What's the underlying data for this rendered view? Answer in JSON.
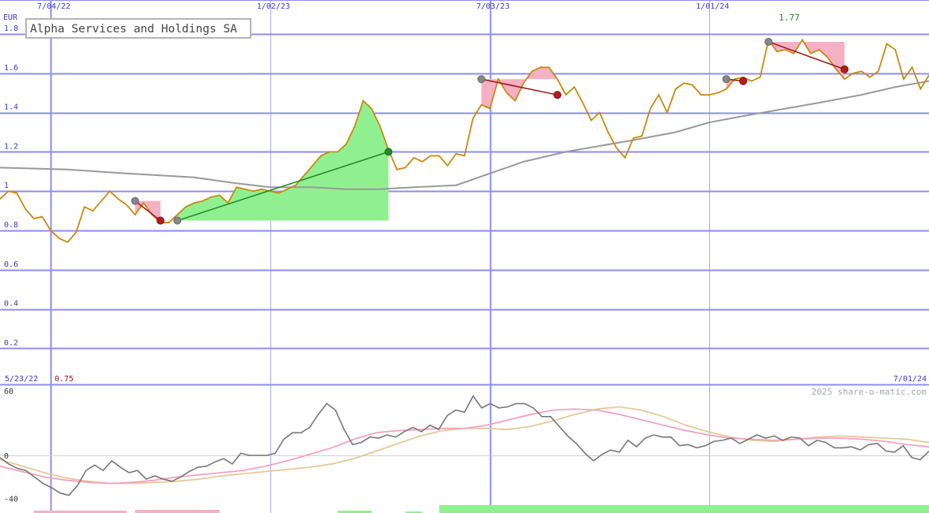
{
  "chart_data": [
    {
      "type": "line",
      "title": "Alpha Services and Holdings SA",
      "currency_label": "EUR",
      "top_date_labels": [
        "7/04/22",
        "1/02/23",
        "7/03/23",
        "1/01/24"
      ],
      "y_ticks": [
        "1.8",
        "1.6",
        "1.4",
        "1.2",
        "1",
        "0.8",
        "0.6",
        "0.4",
        "0.2"
      ],
      "ylim": [
        0,
        1.8
      ],
      "high_label": "1.77",
      "low_label": "0.75",
      "colors": {
        "price": "#c88a10",
        "average": "#999999",
        "grid_major": "#8c8cf0",
        "axis_text": "#3a3acc",
        "gain_fill": "#90f090",
        "loss_fill": "#f6b0c4",
        "gain_line": "#228822",
        "loss_line": "#991111",
        "high_text": "#228822",
        "low_text": "#991111"
      },
      "series": [
        {
          "name": "price",
          "x": [
            "2022-05-23",
            "2022-05-30",
            "2022-06-06",
            "2022-06-13",
            "2022-06-20",
            "2022-06-27",
            "2022-07-04",
            "2022-07-11",
            "2022-07-18",
            "2022-07-25",
            "2022-08-01",
            "2022-08-08",
            "2022-08-15",
            "2022-08-22",
            "2022-08-29",
            "2022-09-05",
            "2022-09-12",
            "2022-09-19",
            "2022-09-26",
            "2022-10-03",
            "2022-10-10",
            "2022-10-17",
            "2022-10-24",
            "2022-10-31",
            "2022-11-07",
            "2022-11-14",
            "2022-11-21",
            "2022-11-28",
            "2022-12-05",
            "2022-12-12",
            "2022-12-19",
            "2022-12-26",
            "2023-01-02",
            "2023-01-09",
            "2023-01-16",
            "2023-01-23",
            "2023-01-30",
            "2023-02-06",
            "2023-02-13",
            "2023-02-20",
            "2023-02-27",
            "2023-03-06",
            "2023-03-13",
            "2023-03-20",
            "2023-03-27",
            "2023-04-03",
            "2023-04-10",
            "2023-04-17",
            "2023-04-24",
            "2023-05-01",
            "2023-05-08",
            "2023-05-15",
            "2023-05-22",
            "2023-05-29",
            "2023-06-05",
            "2023-06-12",
            "2023-06-19",
            "2023-06-26",
            "2023-07-03",
            "2023-07-10",
            "2023-07-17",
            "2023-07-24",
            "2023-07-31",
            "2023-08-07",
            "2023-08-14",
            "2023-08-21",
            "2023-08-28",
            "2023-09-04",
            "2023-09-11",
            "2023-09-18",
            "2023-09-25",
            "2023-10-02",
            "2023-10-09",
            "2023-10-16",
            "2023-10-23",
            "2023-10-30",
            "2023-11-06",
            "2023-11-13",
            "2023-11-20",
            "2023-11-27",
            "2023-12-04",
            "2023-12-11",
            "2023-12-18",
            "2023-12-25",
            "2024-01-01",
            "2024-01-08",
            "2024-01-15",
            "2024-01-22",
            "2024-01-29",
            "2024-02-05",
            "2024-02-12",
            "2024-02-19",
            "2024-02-26",
            "2024-03-04",
            "2024-03-11",
            "2024-03-18",
            "2024-03-25",
            "2024-04-01",
            "2024-04-08",
            "2024-04-15",
            "2024-04-22",
            "2024-04-29",
            "2024-05-06",
            "2024-05-13",
            "2024-05-20",
            "2024-05-27",
            "2024-06-03",
            "2024-06-10",
            "2024-06-17",
            "2024-06-24",
            "2024-07-01"
          ],
          "y": [
            0.96,
            1.0,
            0.99,
            0.91,
            0.86,
            0.87,
            0.8,
            0.76,
            0.74,
            0.79,
            0.92,
            0.9,
            0.95,
            1.0,
            0.96,
            0.93,
            0.88,
            0.94,
            0.88,
            0.84,
            0.84,
            0.88,
            0.92,
            0.94,
            0.95,
            0.97,
            0.98,
            0.94,
            1.02,
            1.01,
            1.0,
            1.01,
            1.0,
            0.99,
            1.01,
            1.03,
            1.08,
            1.13,
            1.18,
            1.2,
            1.2,
            1.24,
            1.33,
            1.46,
            1.42,
            1.33,
            1.21,
            1.11,
            1.12,
            1.17,
            1.15,
            1.18,
            1.18,
            1.13,
            1.19,
            1.18,
            1.37,
            1.44,
            1.42,
            1.57,
            1.5,
            1.46,
            1.55,
            1.61,
            1.63,
            1.63,
            1.57,
            1.49,
            1.53,
            1.45,
            1.36,
            1.4,
            1.3,
            1.22,
            1.17,
            1.27,
            1.28,
            1.42,
            1.49,
            1.4,
            1.52,
            1.55,
            1.54,
            1.49,
            1.49,
            1.5,
            1.52,
            1.57,
            1.58,
            1.56,
            1.58,
            1.77,
            1.71,
            1.72,
            1.7,
            1.77,
            1.7,
            1.72,
            1.68,
            1.62,
            1.57,
            1.6,
            1.61,
            1.58,
            1.61,
            1.75,
            1.72,
            1.57,
            1.63,
            1.52,
            1.59
          ]
        },
        {
          "name": "average",
          "x": [
            "2022-05-23",
            "2022-07-18",
            "2022-09-05",
            "2022-10-31",
            "2022-12-05",
            "2023-01-02",
            "2023-02-06",
            "2023-03-06",
            "2023-04-03",
            "2023-05-01",
            "2023-06-05",
            "2023-07-03",
            "2023-07-31",
            "2023-09-04",
            "2023-10-02",
            "2023-10-30",
            "2023-12-04",
            "2024-01-01",
            "2024-02-05",
            "2024-03-04",
            "2024-04-01",
            "2024-05-06",
            "2024-06-03",
            "2024-07-01"
          ],
          "y": [
            1.12,
            1.11,
            1.09,
            1.07,
            1.04,
            1.02,
            1.02,
            1.01,
            1.01,
            1.02,
            1.03,
            1.09,
            1.15,
            1.2,
            1.23,
            1.26,
            1.3,
            1.35,
            1.39,
            1.42,
            1.45,
            1.49,
            1.53,
            1.56
          ]
        }
      ],
      "trades": [
        {
          "result": "loss",
          "entry_date": "2022-09-12",
          "entry_price": 0.95,
          "exit_date": "2022-10-03",
          "exit_price": 0.85
        },
        {
          "result": "gain",
          "entry_date": "2022-10-17",
          "entry_price": 0.85,
          "exit_date": "2023-04-10",
          "exit_price": 1.2
        },
        {
          "result": "loss",
          "entry_date": "2023-06-26",
          "entry_price": 1.57,
          "exit_date": "2023-08-28",
          "exit_price": 1.49
        },
        {
          "result": "loss",
          "entry_date": "2024-01-15",
          "entry_price": 1.57,
          "exit_date": "2024-01-29",
          "exit_price": 1.56
        },
        {
          "result": "loss",
          "entry_date": "2024-02-19",
          "entry_price": 1.76,
          "exit_date": "2024-04-22",
          "exit_price": 1.62
        }
      ]
    },
    {
      "type": "line",
      "start_date_label": "5/23/22",
      "end_date_label": "7/01/24",
      "watermark": "2025 share-o-matic.com",
      "y_ticks": [
        "60",
        "0",
        "-40"
      ],
      "ylim": [
        -40,
        60
      ],
      "colors": {
        "oscillator": "#777777",
        "signal_pink": "#f4a2c0",
        "signal_tan": "#e6c89a",
        "bar_positive": "#90f090",
        "bar_negative": "#f6b0c4"
      },
      "series": [
        {
          "name": "oscillator",
          "values": [
            -2,
            -8,
            -12,
            -14,
            -20,
            -26,
            -30,
            -35,
            -37,
            -28,
            -14,
            -9,
            -14,
            -5,
            -11,
            -16,
            -14,
            -22,
            -19,
            -22,
            -24,
            -20,
            -15,
            -11,
            -10,
            -6,
            -3,
            -8,
            2,
            0,
            0,
            0,
            2,
            15,
            21,
            21,
            26,
            38,
            48,
            42,
            24,
            10,
            12,
            17,
            16,
            19,
            17,
            22,
            26,
            22,
            28,
            24,
            37,
            42,
            40,
            55,
            44,
            48,
            44,
            45,
            48,
            48,
            44,
            36,
            36,
            27,
            18,
            11,
            2,
            -5,
            1,
            5,
            3,
            14,
            8,
            16,
            19,
            17,
            17,
            9,
            10,
            7,
            9,
            13,
            14,
            16,
            11,
            15,
            19,
            16,
            18,
            14,
            17,
            16,
            9,
            14,
            12,
            7,
            7,
            8,
            5,
            10,
            11,
            4,
            3,
            9,
            -2,
            -4,
            4
          ],
          "x_start": "2022-05-23",
          "x_end": "2024-07-01"
        },
        {
          "name": "signal-pink",
          "values": [
            -10,
            -15,
            -20,
            -23,
            -25,
            -26,
            -25,
            -23,
            -20,
            -18,
            -16,
            -14,
            -10,
            -5,
            1,
            7,
            15,
            21,
            23,
            24,
            25,
            25,
            28,
            33,
            38,
            42,
            43,
            42,
            38,
            33,
            28,
            23,
            19,
            16,
            15,
            14,
            15,
            16,
            16,
            15,
            13,
            10,
            8
          ],
          "x_start": "2022-05-23",
          "x_end": "2024-07-01"
        },
        {
          "name": "signal-tan",
          "values": [
            -4,
            -10,
            -16,
            -21,
            -24,
            -26,
            -26,
            -25,
            -24,
            -22,
            -19,
            -17,
            -15,
            -13,
            -11,
            -8,
            -3,
            4,
            11,
            18,
            23,
            25,
            25,
            24,
            27,
            32,
            38,
            43,
            45,
            42,
            36,
            28,
            22,
            17,
            14,
            13,
            15,
            17,
            18,
            17,
            16,
            15,
            12
          ],
          "x_start": "2022-05-23",
          "x_end": "2024-07-01"
        }
      ],
      "bars": [
        {
          "result": "loss",
          "from": "2022-06-20",
          "to": "2022-09-05",
          "height": 3
        },
        {
          "result": "loss",
          "from": "2022-09-12",
          "to": "2022-11-21",
          "height": 4
        },
        {
          "result": "gain",
          "from": "2023-02-27",
          "to": "2023-03-27",
          "height": 3
        },
        {
          "result": "gain",
          "from": "2023-04-24",
          "to": "2023-05-08",
          "height": 2
        },
        {
          "result": "gain",
          "from": "2023-05-22",
          "to": "2024-07-01",
          "height": 10
        }
      ]
    }
  ]
}
